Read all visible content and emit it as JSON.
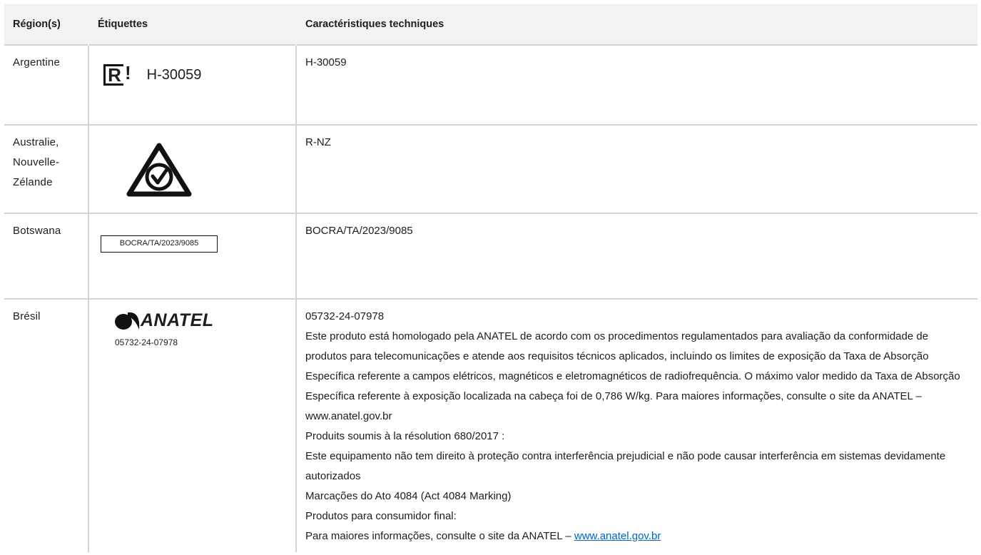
{
  "table": {
    "headers": {
      "region": "Région(s)",
      "labels": "Étiquettes",
      "specs": "Caractéristiques techniques"
    },
    "rows": [
      {
        "region": "Argentine",
        "label_text": "H-30059",
        "spec_lines": [
          "H-30059"
        ]
      },
      {
        "region": "Australie, Nouvelle-Zélande",
        "label_icon": "rcm-compliance-mark-icon",
        "spec_lines": [
          "R-NZ"
        ]
      },
      {
        "region": "Botswana",
        "label_text": "BOCRA/TA/2023/9085",
        "spec_lines": [
          "BOCRA/TA/2023/9085"
        ]
      },
      {
        "region": "Brésil",
        "label_logo": "ANATEL",
        "label_number": "05732-24-07978",
        "spec_lines": [
          "05732-24-07978",
          "Este produto está homologado pela ANATEL de acordo com os procedimentos regulamentados para avaliação da conformidade de produtos para telecomunicações e atende aos requisitos técnicos aplicados, incluindo os limites de exposição da Taxa de Absorção Específica referente a campos elétricos, magnéticos e eletromagnéticos de radiofre­quência. O máximo valor medido da Taxa de Absorção Específica referente à exposição localizada na cabeça foi de 0,786 W/kg. Para maiores informações, consulte o site da ANATEL – www.anatel.gov.br",
          "Produits soumis à la résolution 680/2017 :",
          "Este equipamento não tem direito à proteção contra interferência prejudicial e não pode causar interferência em sis­temas devidamente autorizados",
          "Marcações do Ato 4084 (Act 4084 Marking)",
          "Produtos para consumidor final:"
        ],
        "spec_last_prefix": "Para maiores informações, consulte o site da ANATEL – ",
        "spec_last_link": "www.anatel.gov.br"
      }
    ]
  }
}
